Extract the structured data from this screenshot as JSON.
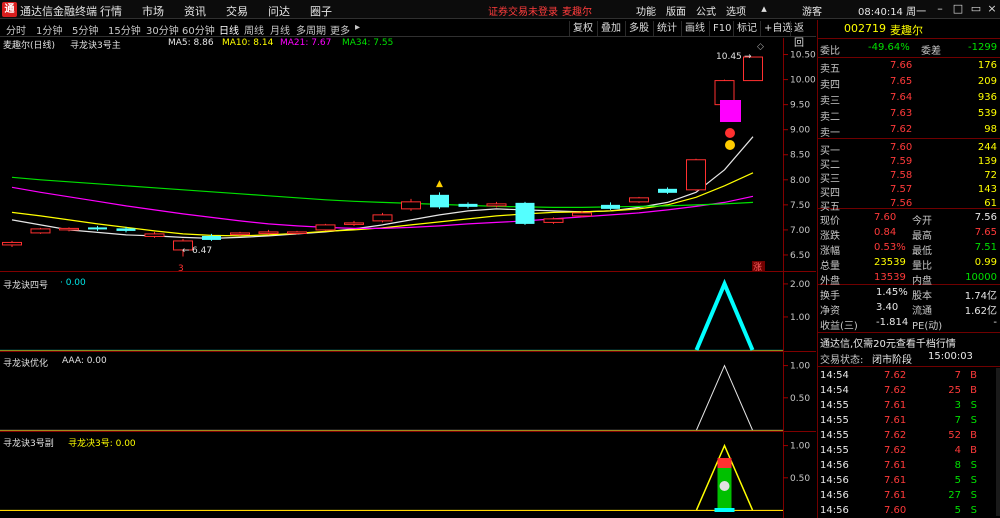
{
  "titlebar": {
    "logo_text": "通",
    "app_name": "通达信金融终端",
    "menus": [
      "行情",
      "市场",
      "资讯",
      "交易",
      "问达",
      "圈子"
    ],
    "warning": "证券交易未登录",
    "stock_name_title": "麦趣尔",
    "right_menus": [
      "功能",
      "版面",
      "公式",
      "选项"
    ],
    "guest": "游客",
    "clock": "08:40:14 周一"
  },
  "toolbar": {
    "periods": [
      "分时",
      "1分钟",
      "5分钟",
      "15分钟",
      "30分钟",
      "60分钟",
      "日线",
      "周线",
      "月线",
      "多周期",
      "更多"
    ],
    "active_period": "日线",
    "buttons": [
      "复权",
      "叠加",
      "多股",
      "统计",
      "画线",
      "F10",
      "标记",
      "+自选",
      "返回"
    ]
  },
  "main_chart": {
    "title": "麦趣尔(日线)",
    "indicator": "寻龙诀3号主",
    "ma_labels": [
      {
        "text": "MA5: 8.86",
        "color": "#e6e6e6"
      },
      {
        "text": "MA10: 8.14",
        "color": "#ffff00"
      },
      {
        "text": "MA21: 7.67",
        "color": "#ff00ff"
      },
      {
        "text": "MA34: 7.55",
        "color": "#00e000"
      }
    ],
    "y_ticks": [
      "10.50",
      "10.00",
      "9.50",
      "9.00",
      "8.50",
      "8.00",
      "7.50",
      "7.00",
      "6.50"
    ],
    "high_label": "10.45",
    "low_label": "6.47",
    "marker_left": "3",
    "marker_right": "涨"
  },
  "panels": [
    {
      "title": "寻龙诀四号",
      "value_label": "· 0.00",
      "y_ticks": [
        "2.00",
        "1.00"
      ]
    },
    {
      "title": "寻龙诀优化",
      "value_label": "AAA: 0.00",
      "y_ticks": [
        "1.00",
        "0.50"
      ]
    },
    {
      "title": "寻龙诀3号副",
      "value_label": "寻龙决3号: 0.00",
      "y_ticks": [
        "1.00",
        "0.50"
      ]
    }
  ],
  "right_panel": {
    "code": "002719",
    "name": "麦趣尔",
    "wei_bi_label": "委比",
    "wei_bi": "-49.64%",
    "wei_cha_label": "委差",
    "wei_cha": "-1299",
    "asks": [
      {
        "label": "卖五",
        "price": "7.66",
        "vol": "176"
      },
      {
        "label": "卖四",
        "price": "7.65",
        "vol": "209"
      },
      {
        "label": "卖三",
        "price": "7.64",
        "vol": "936"
      },
      {
        "label": "卖二",
        "price": "7.63",
        "vol": "539"
      },
      {
        "label": "卖一",
        "price": "7.62",
        "vol": "98"
      }
    ],
    "bids": [
      {
        "label": "买一",
        "price": "7.60",
        "vol": "244"
      },
      {
        "label": "买二",
        "price": "7.59",
        "vol": "139"
      },
      {
        "label": "买三",
        "price": "7.58",
        "vol": "72"
      },
      {
        "label": "买四",
        "price": "7.57",
        "vol": "143"
      },
      {
        "label": "买五",
        "price": "7.56",
        "vol": "61"
      }
    ],
    "quote": [
      {
        "l1": "现价",
        "v1": "7.60",
        "c1": "red",
        "l2": "今开",
        "v2": "7.56",
        "c2": "white"
      },
      {
        "l1": "涨跌",
        "v1": "0.84",
        "c1": "red",
        "l2": "最高",
        "v2": "7.65",
        "c2": "red"
      },
      {
        "l1": "涨幅",
        "v1": "0.53%",
        "c1": "red",
        "l2": "最低",
        "v2": "7.51",
        "c2": "green"
      },
      {
        "l1": "总量",
        "v1": "23539",
        "c1": "yellow",
        "l2": "量比",
        "v2": "0.99",
        "c2": "yellow"
      },
      {
        "l1": "外盘",
        "v1": "13539",
        "c1": "red",
        "l2": "内盘",
        "v2": "10000",
        "c2": "green"
      }
    ],
    "stats": [
      {
        "l1": "换手",
        "v1": "1.45%",
        "l2": "股本",
        "v2": "1.74亿"
      },
      {
        "l1": "净资",
        "v1": "3.40",
        "l2": "流通",
        "v2": "1.62亿"
      },
      {
        "l1": "收益(三)",
        "v1": "-1.814",
        "l2": "PE(动)",
        "v2": "-"
      }
    ],
    "promo": "通达信,仅需20元查看千档行情",
    "trade_status_label": "交易状态:",
    "trade_status": "闭市阶段",
    "trade_time": "15:00:03",
    "ticks": [
      {
        "t": "14:54",
        "p": "7.62",
        "v": "7",
        "d": "B"
      },
      {
        "t": "14:54",
        "p": "7.62",
        "v": "25",
        "d": "B"
      },
      {
        "t": "14:55",
        "p": "7.61",
        "v": "3",
        "d": "S"
      },
      {
        "t": "14:55",
        "p": "7.61",
        "v": "7",
        "d": "S"
      },
      {
        "t": "14:55",
        "p": "7.62",
        "v": "52",
        "d": "B"
      },
      {
        "t": "14:55",
        "p": "7.62",
        "v": "4",
        "d": "B"
      },
      {
        "t": "14:56",
        "p": "7.61",
        "v": "8",
        "d": "S"
      },
      {
        "t": "14:56",
        "p": "7.61",
        "v": "5",
        "d": "S"
      },
      {
        "t": "14:56",
        "p": "7.61",
        "v": "27",
        "d": "S"
      },
      {
        "t": "14:56",
        "p": "7.60",
        "v": "5",
        "d": "S"
      }
    ]
  },
  "candles": [
    {
      "o": 6.7,
      "c": 6.75,
      "h": 6.78,
      "l": 6.66
    },
    {
      "o": 6.94,
      "c": 7.02,
      "h": 7.04,
      "l": 6.92
    },
    {
      "o": 7.0,
      "c": 7.03,
      "h": 7.05,
      "l": 6.97
    },
    {
      "o": 7.05,
      "c": 7.01,
      "h": 7.08,
      "l": 6.98
    },
    {
      "o": 7.03,
      "c": 6.98,
      "h": 7.06,
      "l": 6.95
    },
    {
      "o": 6.87,
      "c": 6.92,
      "h": 6.96,
      "l": 6.84
    },
    {
      "o": 6.6,
      "c": 6.78,
      "h": 6.82,
      "l": 6.47
    },
    {
      "o": 6.88,
      "c": 6.8,
      "h": 6.92,
      "l": 6.78
    },
    {
      "o": 6.92,
      "c": 6.94,
      "h": 6.96,
      "l": 6.88
    },
    {
      "o": 6.93,
      "c": 6.96,
      "h": 7.0,
      "l": 6.9
    },
    {
      "o": 6.94,
      "c": 6.96,
      "h": 6.98,
      "l": 6.91
    },
    {
      "o": 7.0,
      "c": 7.1,
      "h": 7.12,
      "l": 6.98
    },
    {
      "o": 7.12,
      "c": 7.14,
      "h": 7.18,
      "l": 7.08
    },
    {
      "o": 7.18,
      "c": 7.3,
      "h": 7.34,
      "l": 7.15
    },
    {
      "o": 7.42,
      "c": 7.56,
      "h": 7.62,
      "l": 7.38
    },
    {
      "o": 7.7,
      "c": 7.45,
      "h": 7.75,
      "l": 7.42
    },
    {
      "o": 7.52,
      "c": 7.46,
      "h": 7.55,
      "l": 7.43
    },
    {
      "o": 7.48,
      "c": 7.52,
      "h": 7.56,
      "l": 7.45
    },
    {
      "o": 7.54,
      "c": 7.12,
      "h": 7.56,
      "l": 7.1
    },
    {
      "o": 7.15,
      "c": 7.22,
      "h": 7.25,
      "l": 7.12
    },
    {
      "o": 7.28,
      "c": 7.34,
      "h": 7.38,
      "l": 7.25
    },
    {
      "o": 7.5,
      "c": 7.42,
      "h": 7.55,
      "l": 7.4
    },
    {
      "o": 7.56,
      "c": 7.64,
      "h": 7.66,
      "l": 7.54
    },
    {
      "o": 7.82,
      "c": 7.74,
      "h": 7.85,
      "l": 7.72
    },
    {
      "o": 7.8,
      "c": 8.4,
      "h": 8.42,
      "l": 7.78
    },
    {
      "o": 9.5,
      "c": 9.98,
      "h": 10.0,
      "l": 9.48
    },
    {
      "o": 9.98,
      "c": 10.45,
      "h": 10.45,
      "l": 9.98
    }
  ],
  "ma_lines": [
    {
      "name": "MA5",
      "color": "#e6e6e6",
      "values": [
        7.2,
        7.1,
        7.0,
        6.95,
        6.9,
        6.88,
        6.85,
        6.83,
        6.85,
        6.88,
        6.92,
        6.96,
        7.02,
        7.1,
        7.2,
        7.3,
        7.38,
        7.42,
        7.4,
        7.38,
        7.36,
        7.38,
        7.45,
        7.55,
        7.75,
        8.2,
        8.86
      ]
    },
    {
      "name": "MA10",
      "color": "#ffff00",
      "values": [
        7.35,
        7.28,
        7.2,
        7.12,
        7.05,
        6.98,
        6.92,
        6.89,
        6.88,
        6.9,
        6.93,
        6.97,
        7.0,
        7.04,
        7.1,
        7.16,
        7.22,
        7.28,
        7.32,
        7.35,
        7.36,
        7.38,
        7.42,
        7.5,
        7.65,
        7.88,
        8.14
      ]
    },
    {
      "name": "MA21",
      "color": "#ff00ff",
      "values": [
        7.85,
        7.75,
        7.66,
        7.57,
        7.48,
        7.4,
        7.32,
        7.25,
        7.18,
        7.12,
        7.08,
        7.05,
        7.03,
        7.03,
        7.05,
        7.08,
        7.12,
        7.15,
        7.18,
        7.22,
        7.26,
        7.3,
        7.34,
        7.4,
        7.47,
        7.55,
        7.67
      ]
    },
    {
      "name": "MA34",
      "color": "#00e000",
      "values": [
        8.05,
        8.0,
        7.96,
        7.92,
        7.88,
        7.84,
        7.8,
        7.76,
        7.72,
        7.68,
        7.64,
        7.6,
        7.57,
        7.55,
        7.53,
        7.51,
        7.49,
        7.47,
        7.46,
        7.45,
        7.45,
        7.46,
        7.47,
        7.48,
        7.5,
        7.52,
        7.55
      ]
    }
  ],
  "indicator_peak": {
    "panel1": 2.0,
    "panel2": 1.0,
    "panel3": 1.0
  }
}
